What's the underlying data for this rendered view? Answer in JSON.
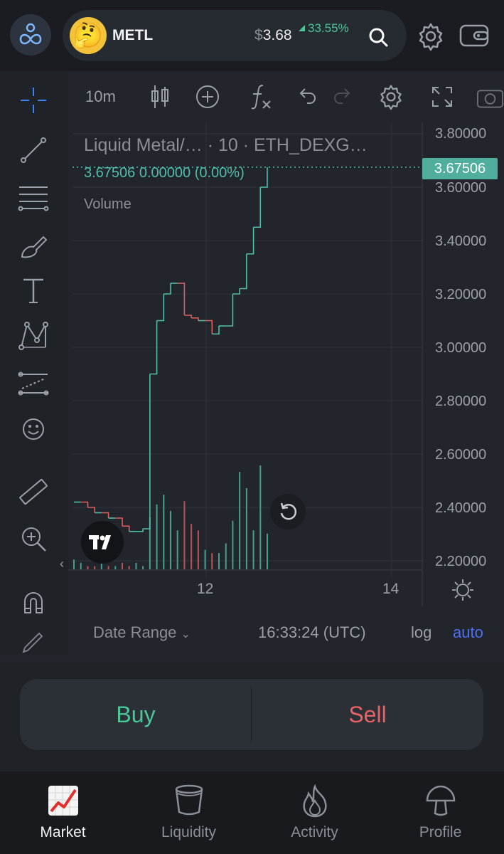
{
  "header": {
    "token_symbol": "METL",
    "price_currency": "$",
    "price": "3.68",
    "change": "33.55%",
    "avatar_emoji": "🤔"
  },
  "toolbar": {
    "interval": "10m"
  },
  "chart": {
    "legend_title": "Liquid Metal/…  · 10 · ETH_DEXG…",
    "legend_values": "3.67506  0.00000 (0.00%)",
    "volume_label": "Volume",
    "last_price_tag": "3.67506",
    "y_ticks": [
      "3.80000",
      "3.60000",
      "3.40000",
      "3.20000",
      "3.00000",
      "2.80000",
      "2.60000",
      "2.40000",
      "2.20000"
    ],
    "x_ticks": [
      "12",
      "14"
    ],
    "colors": {
      "up": "#4fbfa8",
      "down": "#e0605e",
      "grid": "#30343b"
    }
  },
  "chart_data": {
    "type": "line",
    "ylim": [
      2.2,
      3.8
    ],
    "series": [
      {
        "values": [
          2.42,
          2.42,
          2.4,
          2.38,
          2.38,
          2.36,
          2.36,
          2.33,
          2.31,
          2.31,
          2.32,
          2.9,
          3.1,
          3.2,
          3.24,
          3.24,
          3.12,
          3.11,
          3.1,
          3.1,
          3.05,
          3.08,
          3.08,
          3.2,
          3.22,
          3.35,
          3.45,
          3.6,
          3.67506
        ]
      }
    ],
    "volume": [
      0.3,
      0.2,
      0.1,
      0.1,
      0.2,
      0.1,
      0.1,
      0.2,
      0.1,
      0.2,
      0.1,
      1.6,
      2.0,
      2.3,
      1.8,
      1.2,
      2.1,
      1.4,
      1.2,
      0.6,
      0.5,
      0.5,
      0.8,
      1.5,
      3.0,
      2.5,
      1.2,
      3.2,
      1.1
    ]
  },
  "footer_controls": {
    "date_range": "Date Range",
    "clock": "16:33:24 (UTC)",
    "log": "log",
    "auto": "auto"
  },
  "trade": {
    "buy": "Buy",
    "sell": "Sell"
  },
  "nav": {
    "items": [
      {
        "label": "Market"
      },
      {
        "label": "Liquidity"
      },
      {
        "label": "Activity"
      },
      {
        "label": "Profile"
      }
    ]
  }
}
